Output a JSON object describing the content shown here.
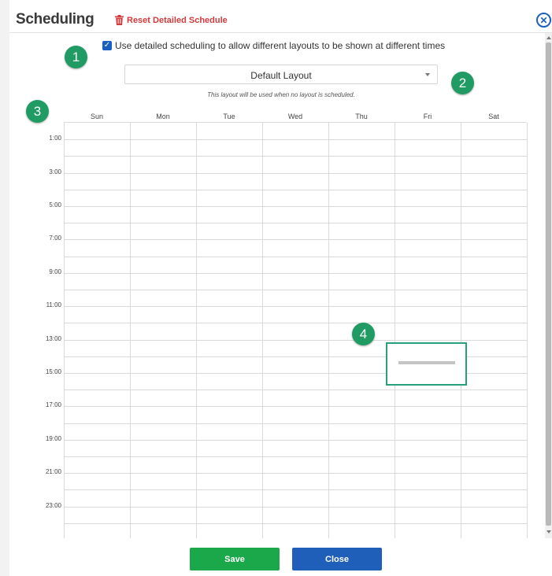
{
  "header": {
    "title": "Scheduling",
    "reset_label": "Reset Detailed Schedule"
  },
  "options": {
    "use_detailed_label": "Use detailed scheduling to allow different layouts to be shown at different times",
    "use_detailed_checked": true,
    "layout_value": "Default Layout",
    "layout_note": "This layout will be used when no layout is scheduled."
  },
  "calendar": {
    "days": [
      "Sun",
      "Mon",
      "Tue",
      "Wed",
      "Thu",
      "Fri",
      "Sat"
    ],
    "time_labels": [
      "1:00",
      "3:00",
      "5:00",
      "7:00",
      "9:00",
      "11:00",
      "13:00",
      "15:00",
      "17:00",
      "19:00",
      "21:00",
      "23:00"
    ]
  },
  "callouts": [
    "1",
    "2",
    "3",
    "4"
  ],
  "footer": {
    "save_label": "Save",
    "close_label": "Close"
  },
  "colors": {
    "accent_green": "#1aa84b",
    "accent_blue": "#1f5fba",
    "danger_red": "#d23b3b",
    "callout_green": "#1f9b63"
  }
}
